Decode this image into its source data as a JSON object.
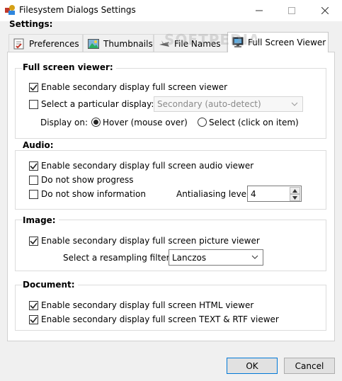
{
  "window": {
    "title": "Filesystem Dialogs Settings",
    "minimize_icon": "minimize-icon",
    "maximize_icon": "maximize-icon",
    "close_icon": "close-icon"
  },
  "settings_label": "Settings:",
  "watermark": "SOFTPEDIA",
  "tabs": [
    {
      "label": "Preferences",
      "icon": "checklist-icon"
    },
    {
      "label": "Thumbnails",
      "icon": "picture-icon"
    },
    {
      "label": "File Names",
      "icon": "airplane-icon"
    },
    {
      "label": "Full Screen Viewer",
      "icon": "monitor-icon",
      "active": true
    }
  ],
  "groups": {
    "fullscreen": {
      "title": "Full screen viewer:",
      "enable_secondary": {
        "label": "Enable secondary display full screen viewer",
        "checked": true
      },
      "select_particular": {
        "label": "Select a particular display:",
        "checked": false
      },
      "display_combo": "Secondary (auto-detect)",
      "display_on_label": "Display on:",
      "hover_radio": {
        "label": "Hover (mouse over)",
        "selected": true
      },
      "select_radio": {
        "label": "Select (click on item)",
        "selected": false
      }
    },
    "audio": {
      "title": "Audio:",
      "enable_audio": {
        "label": "Enable secondary display full screen audio viewer",
        "checked": true
      },
      "no_progress": {
        "label": "Do not show progress",
        "checked": false
      },
      "no_information": {
        "label": "Do not show information",
        "checked": false
      },
      "antialiasing_label": "Antialiasing level:",
      "antialiasing_value": "4"
    },
    "image": {
      "title": "Image:",
      "enable_picture": {
        "label": "Enable secondary display full screen picture viewer",
        "checked": true
      },
      "resampling_label": "Select a resampling filter:",
      "resampling_value": "Lanczos"
    },
    "document": {
      "title": "Document:",
      "enable_html": {
        "label": "Enable secondary display full screen HTML viewer",
        "checked": true
      },
      "enable_text": {
        "label": "Enable secondary display full screen TEXT & RTF viewer",
        "checked": true
      }
    }
  },
  "buttons": {
    "ok": "OK",
    "cancel": "Cancel"
  },
  "colors": {
    "accent": "#0078d7",
    "panel": "#ffffff",
    "chrome": "#f0f0f0"
  }
}
